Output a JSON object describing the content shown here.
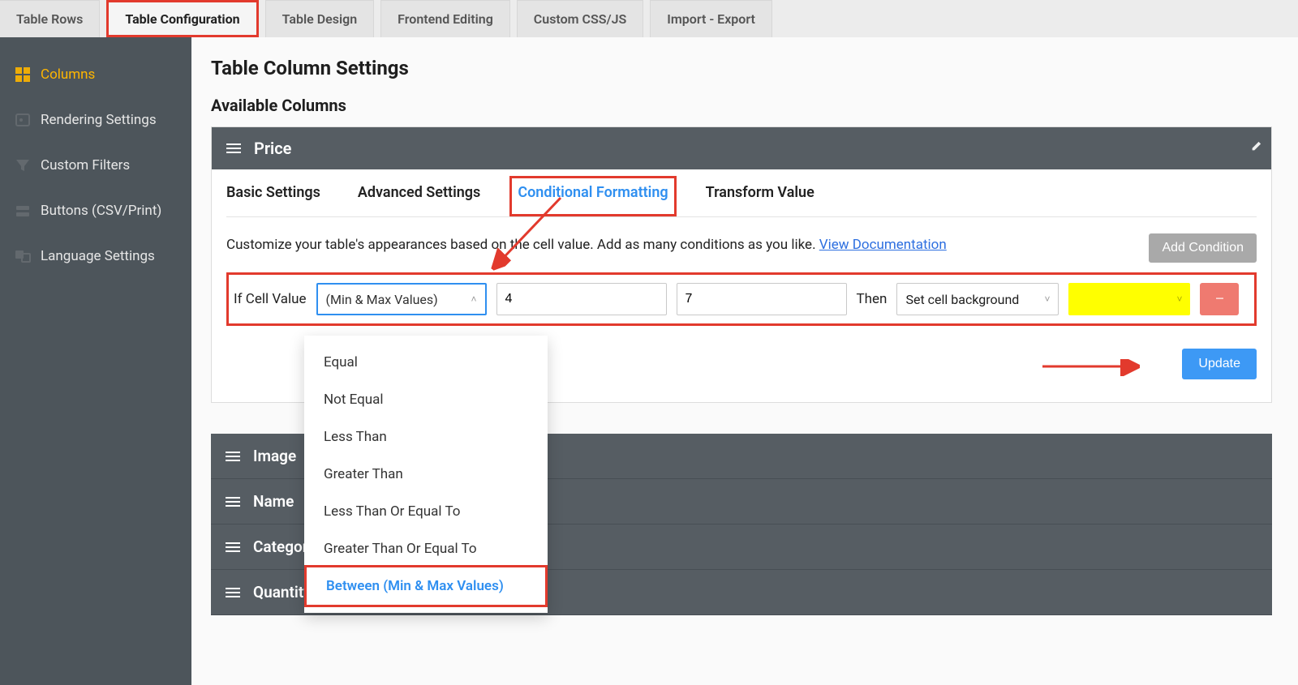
{
  "topTabs": [
    "Table Rows",
    "Table Configuration",
    "Table Design",
    "Frontend Editing",
    "Custom CSS/JS",
    "Import - Export"
  ],
  "topTabActiveIndex": 1,
  "sidebar": {
    "items": [
      {
        "label": "Columns",
        "icon": "columns-grid-icon",
        "active": true
      },
      {
        "label": "Rendering Settings",
        "icon": "render-icon",
        "active": false
      },
      {
        "label": "Custom Filters",
        "icon": "filter-icon",
        "active": false
      },
      {
        "label": "Buttons (CSV/Print)",
        "icon": "buttons-icon",
        "active": false
      },
      {
        "label": "Language Settings",
        "icon": "language-icon",
        "active": false
      }
    ]
  },
  "page": {
    "title": "Table Column Settings",
    "section": "Available Columns"
  },
  "column": {
    "name": "Price",
    "innerTabs": [
      "Basic Settings",
      "Advanced Settings",
      "Conditional Formatting",
      "Transform Value"
    ],
    "innerTabActiveIndex": 2,
    "desc_pre": "Customize your table's appearances based on the cell value. Add as many conditions as you like. ",
    "desc_link": "View Documentation",
    "addCondition": "Add Condition",
    "cond": {
      "ifLabel": "If Cell Value",
      "operatorDisplay": "(Min & Max Values)",
      "min": "4",
      "max": "7",
      "thenLabel": "Then",
      "action": "Set cell background",
      "color": "#ffff00"
    },
    "dropdownOptions": [
      "Equal",
      "Not Equal",
      "Less Than",
      "Greater Than",
      "Less Than Or Equal To",
      "Greater Than Or Equal To",
      "Between (Min & Max Values)"
    ],
    "dropdownSelectedIndex": 6,
    "updateLabel": "Update"
  },
  "otherColumns": [
    "Image",
    "Name",
    "Category",
    "Quantity"
  ]
}
